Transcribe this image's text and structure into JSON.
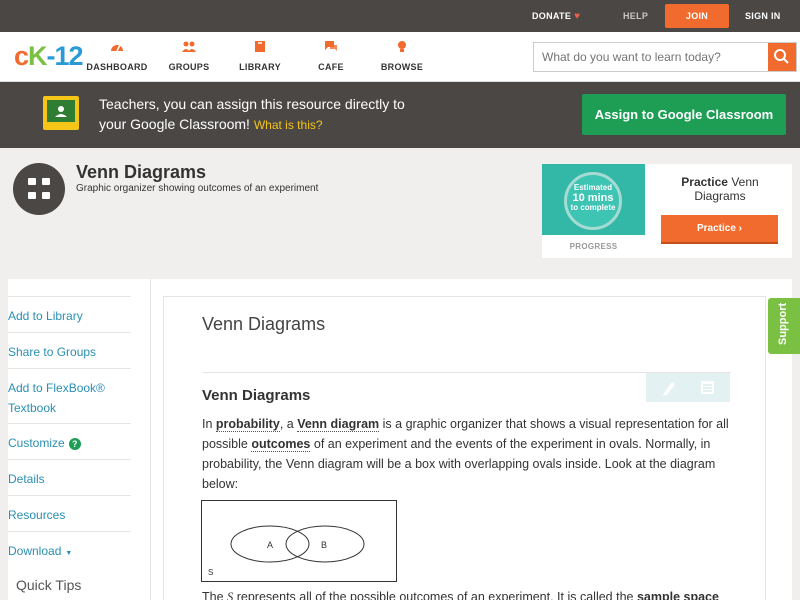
{
  "topbar": {
    "donate": "DONATE",
    "help": "HELP",
    "join": "JOIN",
    "signin": "SIGN IN"
  },
  "logo": {
    "part1": "c",
    "part2": "K",
    "part3": "-12"
  },
  "nav": {
    "items": [
      {
        "label": "DASHBOARD",
        "icon": "dashboard-icon"
      },
      {
        "label": "GROUPS",
        "icon": "groups-icon"
      },
      {
        "label": "LIBRARY",
        "icon": "library-icon"
      },
      {
        "label": "CAFE",
        "icon": "cafe-icon"
      },
      {
        "label": "BROWSE",
        "icon": "browse-icon"
      }
    ],
    "search_placeholder": "What do you want to learn today?"
  },
  "banner": {
    "line1": "Teachers, you can assign this resource directly to",
    "line2": "your Google Classroom!",
    "what_link": "What is this?",
    "assign_label": "Assign to Google Classroom"
  },
  "concept": {
    "title": "Venn Diagrams",
    "subtitle": "Graphic organizer showing outcomes of an experiment"
  },
  "practice": {
    "estimate_line1": "Estimated",
    "estimate_line2": "10 mins",
    "estimate_line3": "to complete",
    "progress_label": "PROGRESS",
    "title_bold": "Practice",
    "title_rest": "Venn",
    "title_line2": "Diagrams",
    "button_label": "Practice"
  },
  "sidebar": {
    "items": [
      {
        "label": "Add to Library"
      },
      {
        "label": "Share to Groups"
      },
      {
        "label": "Add to FlexBook® Textbook"
      },
      {
        "label": "Customize"
      },
      {
        "label": "Details"
      },
      {
        "label": "Resources"
      },
      {
        "label": "Download"
      }
    ],
    "quick_tips": "Quick Tips"
  },
  "article": {
    "title": "Venn Diagrams",
    "section_title": "Venn Diagrams",
    "para_1": "In ",
    "kw_1": "probability",
    "para_2": ", a ",
    "kw_2": "Venn diagram",
    "para_3": " is a graphic organizer that shows a visual representation for all possible ",
    "kw_3": "outcomes",
    "para_4": " of an experiment and the events of the experiment in ovals. Normally, in probability, the Venn diagram will be a box with overlapping ovals inside. Look at the diagram below:",
    "venn_a": "A",
    "venn_b": "B",
    "venn_s": "S",
    "para2_start": "The ",
    "para2_var": "S",
    "para2_mid": " represents all of the possible outcomes of an experiment. It is called the ",
    "para2_kw": "sample space"
  },
  "support_tab": "Support",
  "colors": {
    "accent": "#f26b2e",
    "green": "#1e9d55",
    "teal": "#33b8a8",
    "link": "#2a8fb4"
  }
}
